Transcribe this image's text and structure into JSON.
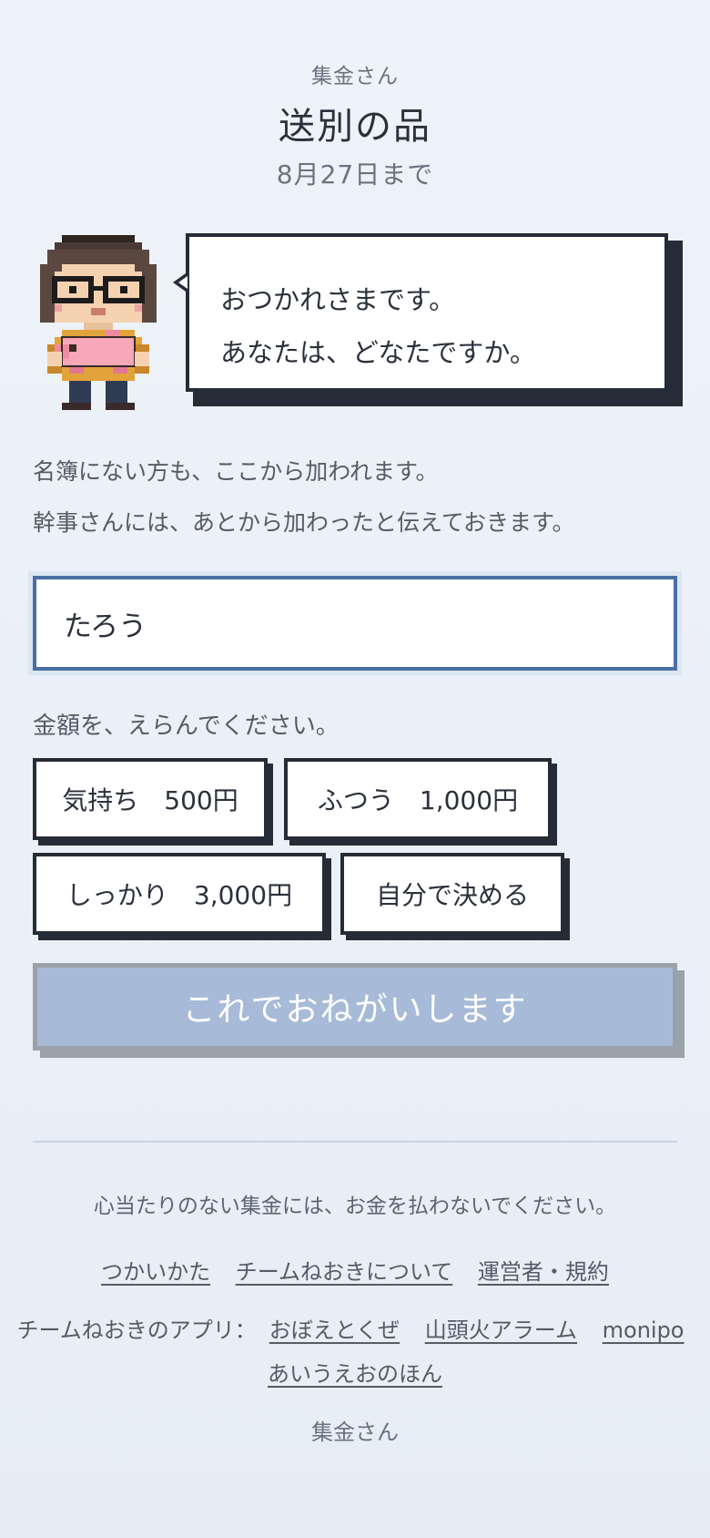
{
  "header": {
    "app_name": "集金さん",
    "event_title": "送別の品",
    "deadline": "8月27日まで"
  },
  "speech": {
    "line1": "おつかれさまです。",
    "line2": "あなたは、どなたですか。"
  },
  "info": {
    "line1": "名簿にない方も、ここから加われます。",
    "line2": "幹事さんには、あとから加わったと伝えておきます。"
  },
  "name_input": {
    "value": "たろう"
  },
  "amount": {
    "label": "金額を、えらんでください。",
    "options": [
      "気持ち　500円",
      "ふつう　1,000円",
      "しっかり　3,000円",
      "自分で決める"
    ]
  },
  "submit_label": "これでおねがいします",
  "footer": {
    "notice": "心当たりのない集金には、お金を払わないでください。",
    "links": [
      "つかいかた",
      "チームねおきについて",
      "運営者・規約"
    ],
    "apps_label": "チームねおきのアプリ：",
    "apps": [
      "おぼえとくぜ",
      "山頭火アラーム",
      "monipo",
      "あいうえおのほん"
    ],
    "app_name": "集金さん"
  },
  "colors": {
    "input_border": "#4a6fa5",
    "submit_disabled": "#a7bbd8",
    "button_border": "#262c37"
  }
}
